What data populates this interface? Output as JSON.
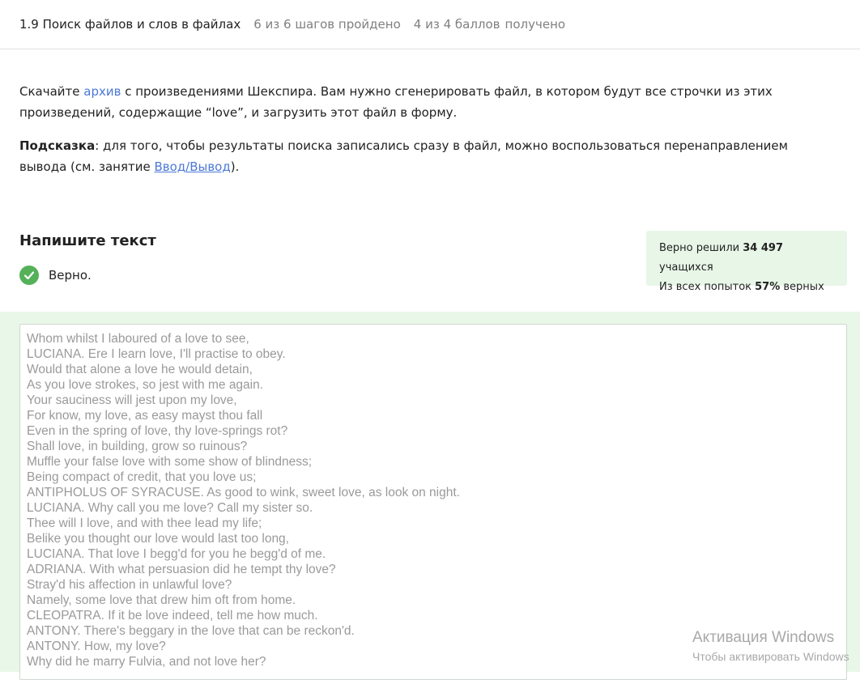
{
  "header": {
    "lesson_title": "1.9 Поиск файлов и слов в файлах",
    "steps_progress": "6 из 6 шагов пройдено",
    "score_progress": "4 из 4 баллов",
    "score_suffix": "получено"
  },
  "task": {
    "p1_prefix": "Скачайте ",
    "p1_link": "архив",
    "p1_suffix": " с произведениями Шекспира. Вам нужно сгенерировать файл, в котором будут все строчки из этих произведений, содержащие “love”, и загрузить этот файл в форму.",
    "hint_label": "Подсказка",
    "hint_text": ": для того, чтобы результаты поиска записались сразу в файл, можно воспользоваться перенаправлением вывода (см. занятие ",
    "hint_link": "Ввод/Вывод",
    "hint_end": ")."
  },
  "answer": {
    "title": "Напишите текст",
    "verdict": "Верно."
  },
  "stats": {
    "solved_prefix": "Верно решили ",
    "solved_count": "34 497",
    "solved_suffix": " учащихся",
    "attempts_prefix": "Из всех попыток ",
    "attempts_percent": "57%",
    "attempts_suffix": " верных"
  },
  "textarea_lines": [
    "Whom whilst I laboured of a love to see,",
    "LUCIANA. Ere I learn love, I'll practise to obey.",
    "Would that alone a love he would detain,",
    "As you love strokes, so jest with me again.",
    "Your sauciness will jest upon my love,",
    "For know, my love, as easy mayst thou fall",
    "Even in the spring of love, thy love-springs rot?",
    "Shall love, in building, grow so ruinous?",
    "Muffle your false love with some show of blindness;",
    "Being compact of credit, that you love us;",
    "ANTIPHOLUS OF SYRACUSE. As good to wink, sweet love, as look on night.",
    "LUCIANA. Why call you me love? Call my sister so.",
    "Thee will I love, and with thee lead my life;",
    "Belike you thought our love would last too long,",
    "LUCIANA. That love I begg'd for you he begg'd of me.",
    "ADRIANA. With what persuasion did he tempt thy love?",
    "Stray'd his affection in unlawful love?",
    "Namely, some love that drew him oft from home.",
    "CLEOPATRA. If it be love indeed, tell me how much.",
    "ANTONY. There's beggary in the love that can be reckon'd.",
    "ANTONY. How, my love?",
    "Why did he marry Fulvia, and not love her?"
  ],
  "watermark": {
    "line1": "Активация Windows",
    "line2": "Чтобы активировать Windows"
  },
  "colors": {
    "link": "#4c79d6",
    "success": "#54b15a",
    "answer_bg": "#e9f7e9",
    "stats_bg": "#e8f6e8"
  }
}
